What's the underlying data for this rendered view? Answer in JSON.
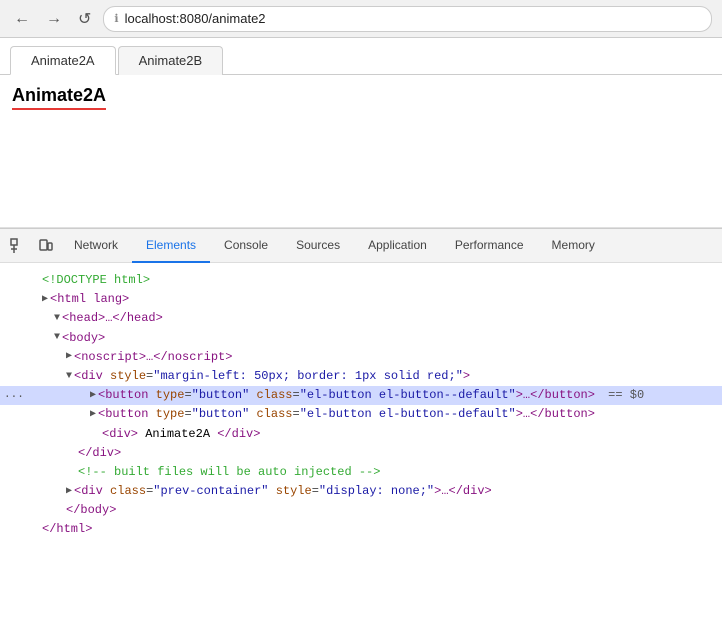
{
  "browser": {
    "url": "localhost:8080/animate2",
    "back_label": "←",
    "forward_label": "→",
    "reload_label": "↺"
  },
  "page": {
    "tabs": [
      {
        "label": "Animate2A",
        "active": true
      },
      {
        "label": "Animate2B",
        "active": false
      }
    ],
    "heading": "Animate2A"
  },
  "devtools": {
    "tabs": [
      {
        "label": "Network",
        "active": false
      },
      {
        "label": "Elements",
        "active": true
      },
      {
        "label": "Console",
        "active": false
      },
      {
        "label": "Sources",
        "active": false
      },
      {
        "label": "Application",
        "active": false
      },
      {
        "label": "Performance",
        "active": false
      },
      {
        "label": "Memory",
        "active": false
      }
    ],
    "code_lines": [
      {
        "indent": 0,
        "arrow": "",
        "content": "<!DOCTYPE html>",
        "type": "doctype",
        "highlighted": false,
        "gutter": ""
      },
      {
        "indent": 0,
        "arrow": "▶",
        "content": "<html lang>",
        "type": "tag",
        "highlighted": false,
        "gutter": ""
      },
      {
        "indent": 0,
        "arrow": "▼",
        "content": "<head>…</head>",
        "type": "tag",
        "highlighted": false,
        "gutter": ""
      },
      {
        "indent": 0,
        "arrow": "▼",
        "content": "<body>",
        "type": "tag",
        "highlighted": false,
        "gutter": ""
      },
      {
        "indent": 1,
        "arrow": "▶",
        "content": "<noscript>…</noscript>",
        "type": "tag",
        "highlighted": false,
        "gutter": ""
      },
      {
        "indent": 1,
        "arrow": "▼",
        "content": "<div style=\"margin-left: 50px; border: 1px solid red;\">",
        "type": "tag",
        "highlighted": false,
        "gutter": ""
      },
      {
        "indent": 2,
        "arrow": "▶",
        "content": "<button type=\"button\" class=\"el-button el-button--default\">…</button>",
        "type": "tag-highlighted",
        "highlighted": true,
        "gutter": "..."
      },
      {
        "indent": 2,
        "arrow": "▶",
        "content": "<button type=\"button\" class=\"el-button el-button--default\">…</button>",
        "type": "tag",
        "highlighted": false,
        "gutter": ""
      },
      {
        "indent": 2,
        "arrow": "",
        "content": "<div> Animate2A </div>",
        "type": "tag",
        "highlighted": false,
        "gutter": ""
      },
      {
        "indent": 1,
        "arrow": "",
        "content": "</div>",
        "type": "tag",
        "highlighted": false,
        "gutter": ""
      },
      {
        "indent": 1,
        "arrow": "",
        "content": "<!-- built files will be auto injected -->",
        "type": "comment",
        "highlighted": false,
        "gutter": ""
      },
      {
        "indent": 1,
        "arrow": "▶",
        "content": "<div class=\"prev-container\" style=\"display: none;\">…</div>",
        "type": "tag",
        "highlighted": false,
        "gutter": ""
      },
      {
        "indent": 0,
        "arrow": "",
        "content": "</body>",
        "type": "tag",
        "highlighted": false,
        "gutter": ""
      },
      {
        "indent": 0,
        "arrow": "",
        "content": "</html>",
        "type": "tag",
        "highlighted": false,
        "gutter": ""
      }
    ]
  }
}
